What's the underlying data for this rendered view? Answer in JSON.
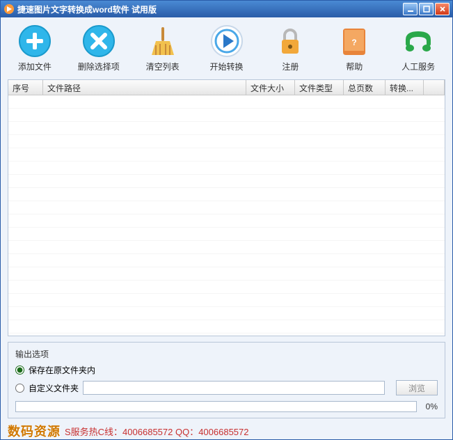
{
  "title": "捷速图片文字转换成word软件  试用版",
  "toolbar": {
    "add": "添加文件",
    "delete": "删除选择项",
    "clear": "清空列表",
    "start": "开始转换",
    "register": "注册",
    "help": "帮助",
    "service": "人工服务"
  },
  "columns": {
    "seq": "序号",
    "path": "文件路径",
    "size": "文件大小",
    "type": "文件类型",
    "pages": "总页数",
    "convert": "转换..."
  },
  "output": {
    "title": "输出选项",
    "save_original": "保存在原文件夹内",
    "custom_folder": "自定义文件夹",
    "custom_path": "",
    "browse": "浏览",
    "progress_pct": "0%"
  },
  "footer": {
    "watermark_left": "数码资源",
    "watermark_right": "S服务热C线：4006685572 QQ：4006685572"
  },
  "colors": {
    "titlebar_start": "#4a8ad4",
    "titlebar_end": "#2a5ca8",
    "accent_blue": "#2fa6e0",
    "accent_orange": "#f0a020"
  }
}
